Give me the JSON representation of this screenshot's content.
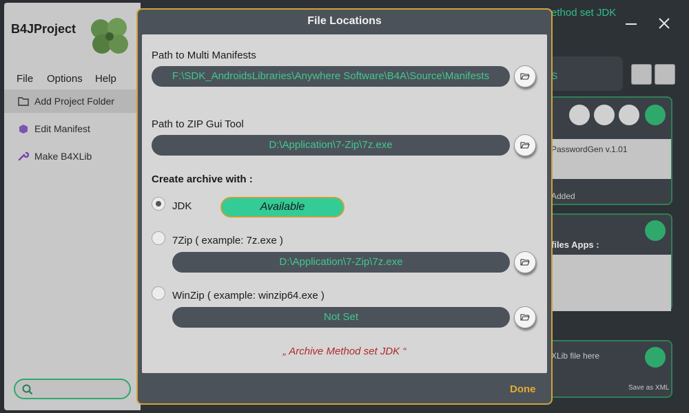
{
  "app": {
    "title": "B4JProject",
    "menu": [
      "File",
      "Options",
      "Help"
    ],
    "sidebar_items": [
      {
        "label": "Add Project Folder",
        "icon": "folder-icon"
      },
      {
        "label": "Edit Manifest",
        "icon": "manifest-icon"
      },
      {
        "label": "Make B4XLib",
        "icon": "wrench-icon"
      }
    ],
    "window_title_fragment": "ethod set JDK"
  },
  "background_panels": {
    "search_fragment": "S",
    "library_row": "PasswordGen v.1.01",
    "added_text": "Added",
    "files_apps_label": "files Apps :",
    "colon_label": ":",
    "drop_hint": "XLib file here",
    "save_as": "Save as XML"
  },
  "dialog": {
    "title": "File Locations",
    "manifests": {
      "label": "Path to Multi Manifests",
      "value": "F:\\SDK_AndroidsLibraries\\Anywhere Software\\B4A\\Source\\Manifests"
    },
    "zip_gui": {
      "label": "Path to ZIP Gui Tool",
      "value": "D:\\Application\\7-Zip\\7z.exe"
    },
    "archive_label": "Create archive with :",
    "options": [
      {
        "label": "JDK",
        "checked": true,
        "status": "Available"
      },
      {
        "label": "7Zip (  example: 7z.exe  )",
        "checked": false,
        "value": "D:\\Application\\7-Zip\\7z.exe"
      },
      {
        "label": "WinZip (  example: winzip64.exe  )",
        "checked": false,
        "value": "Not Set"
      }
    ],
    "archive_status": "„ Archive Method set JDK “",
    "done_label": "Done"
  },
  "colors": {
    "accent_green": "#33cc96",
    "path_text": "#3fc98f",
    "done": "#e3ac2c",
    "status_red": "#b02a2a"
  }
}
